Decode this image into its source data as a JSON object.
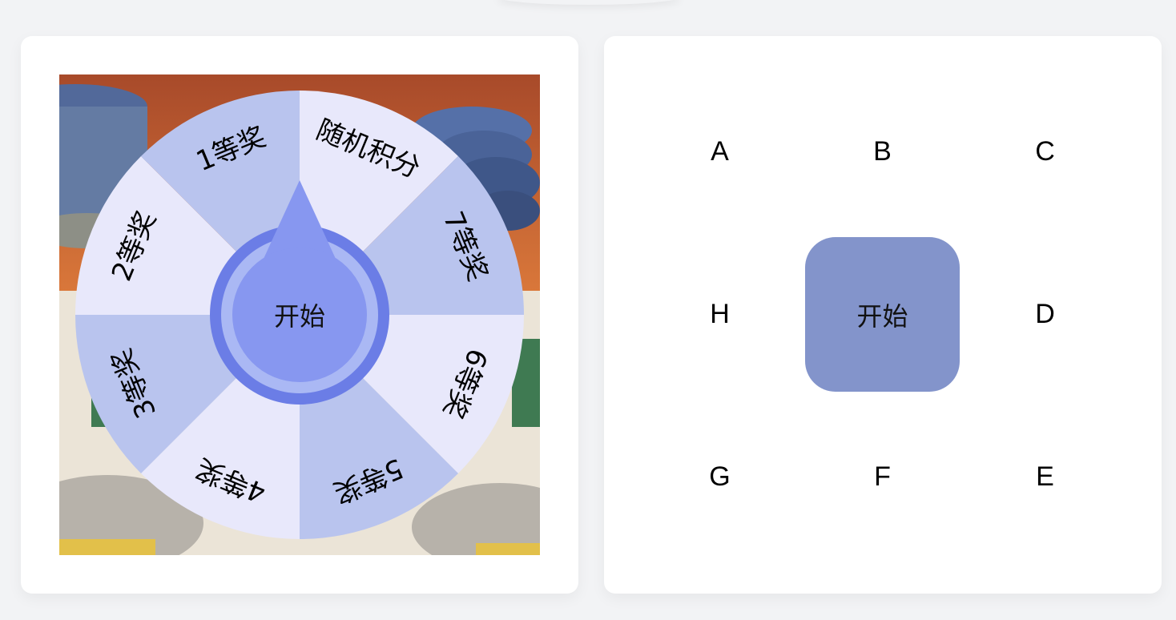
{
  "wheel": {
    "prizes": [
      "随机积分",
      "7等奖",
      "6等奖",
      "5等奖",
      "4等奖",
      "3等奖",
      "2等奖",
      "1等奖"
    ],
    "start_label": "开始",
    "colors": {
      "light": "#e8e8fb",
      "dark": "#b9c4ee",
      "pointer": "#8797f0",
      "ring_outer": "#6b7de6",
      "ring_inner": "#aab8f4"
    }
  },
  "grid": {
    "cells": [
      "A",
      "B",
      "C",
      "D",
      "E",
      "F",
      "G",
      "H"
    ],
    "start_label": "开始",
    "start_color": "#8394cb"
  }
}
